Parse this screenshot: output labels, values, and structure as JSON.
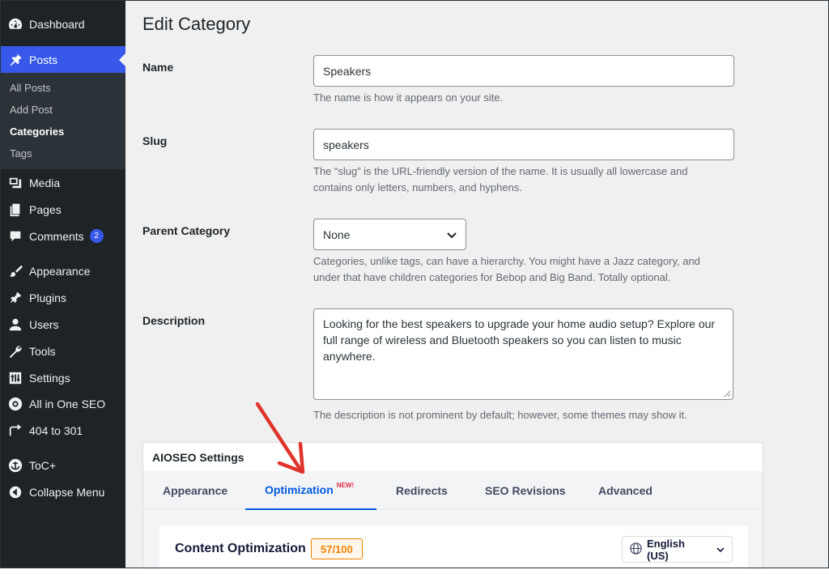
{
  "sidebar": {
    "items": [
      {
        "label": "Dashboard",
        "icon": "dashboard-icon"
      },
      {
        "label": "Posts",
        "icon": "pin-icon"
      },
      {
        "label": "Media",
        "icon": "media-icon"
      },
      {
        "label": "Pages",
        "icon": "pages-icon"
      },
      {
        "label": "Comments",
        "icon": "comment-icon",
        "badge": "2"
      },
      {
        "label": "Appearance",
        "icon": "brush-icon"
      },
      {
        "label": "Plugins",
        "icon": "plug-icon"
      },
      {
        "label": "Users",
        "icon": "user-icon"
      },
      {
        "label": "Tools",
        "icon": "wrench-icon"
      },
      {
        "label": "Settings",
        "icon": "sliders-icon"
      },
      {
        "label": "All in One SEO",
        "icon": "aioseo-icon"
      },
      {
        "label": "404 to 301",
        "icon": "redirect-icon"
      },
      {
        "label": "ToC+",
        "icon": "anchor-icon"
      },
      {
        "label": "Collapse Menu",
        "icon": "collapse-icon"
      }
    ],
    "posts_submenu": [
      "All Posts",
      "Add Post",
      "Categories",
      "Tags"
    ]
  },
  "page": {
    "title": "Edit Category",
    "name_label": "Name",
    "name_value": "Speakers",
    "name_help": "The name is how it appears on your site.",
    "slug_label": "Slug",
    "slug_value": "speakers",
    "slug_help_1": "The “slug” is the URL-friendly version of the name. It is usually all lowercase and",
    "slug_help_2": "contains only letters, numbers, and hyphens.",
    "parent_label": "Parent Category",
    "parent_value": "None",
    "parent_help_1": "Categories, unlike tags, can have a hierarchy. You might have a Jazz category, and",
    "parent_help_2": "under that have children categories for Bebop and Big Band. Totally optional.",
    "description_label": "Description",
    "description_value": "Looking for the best speakers to upgrade your home audio setup? Explore our full range of wireless and Bluetooth speakers so you can listen to music anywhere.",
    "description_help": "The description is not prominent by default; however, some themes may show it."
  },
  "aioseo": {
    "header": "AIOSEO Settings",
    "tabs": [
      {
        "label": "Appearance"
      },
      {
        "label": "Optimization",
        "new": "NEW!"
      },
      {
        "label": "Redirects"
      },
      {
        "label": "SEO Revisions"
      },
      {
        "label": "Advanced"
      }
    ],
    "content_title": "Content Optimization",
    "score": "57/100",
    "language": "English (US)"
  },
  "colors": {
    "sidebar_bg": "#1d2327",
    "accent": "#3858e9",
    "aioseo_blue": "#005ae0",
    "score_orange": "#f18200",
    "annotation_red": "#e0342a"
  }
}
